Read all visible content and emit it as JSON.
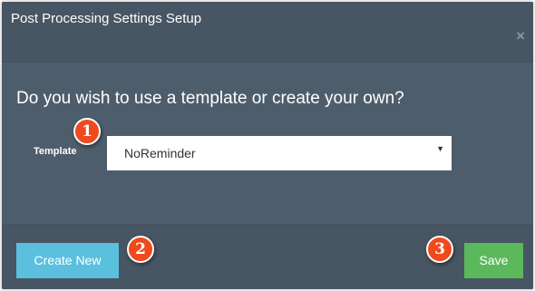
{
  "dialog": {
    "title": "Post Processing Settings Setup",
    "close_label": "×"
  },
  "body": {
    "question": "Do you wish to use a template or create your own?",
    "template_label": "Template",
    "template_select": {
      "selected": "NoReminder",
      "arrow": "▼"
    }
  },
  "footer": {
    "create_new_label": "Create New",
    "save_label": "Save"
  },
  "annotations": {
    "badge_1": "1",
    "badge_2": "2",
    "badge_3": "3"
  },
  "colors": {
    "dialog_background": "#4e5d6c",
    "header_footer_background": "#485563",
    "create_button": "#5bc0de",
    "save_button": "#5cb85c",
    "badge": "#ee4a1e"
  }
}
